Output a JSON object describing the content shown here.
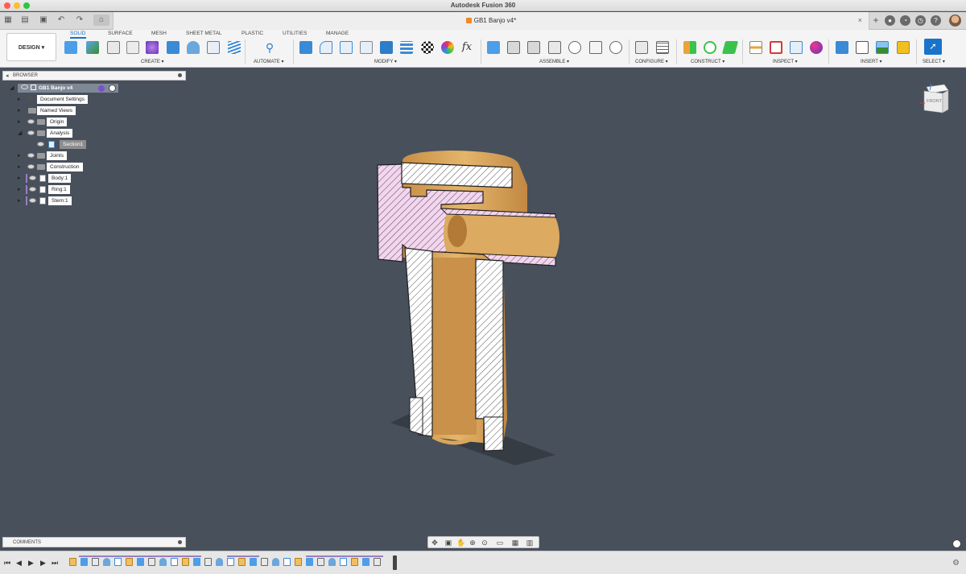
{
  "app": {
    "title": "Autodesk Fusion 360"
  },
  "document_tab": {
    "label": "GB1 Banjo v4*",
    "close": "×"
  },
  "toolbar": {
    "workspace": "DESIGN ▾",
    "tabs": [
      "SOLID",
      "SURFACE",
      "MESH",
      "SHEET METAL",
      "PLASTIC",
      "UTILITIES",
      "MANAGE"
    ],
    "active_tab": "SOLID",
    "groups": [
      "CREATE ▾",
      "AUTOMATE ▾",
      "MODIFY ▾",
      "ASSEMBLE ▾",
      "CONFIGURE ▾",
      "CONSTRUCT ▾",
      "INSPECT ▾",
      "INSERT ▾",
      "SELECT ▾"
    ],
    "fx_label": "fx"
  },
  "browser": {
    "title": "BROWSER",
    "root": "GB1 Banjo v4",
    "items": [
      {
        "label": "Document Settings",
        "icon": "gear-icon"
      },
      {
        "label": "Named Views",
        "icon": "folder-icon"
      },
      {
        "label": "Origin",
        "icon": "folder-icon"
      },
      {
        "label": "Analysis",
        "icon": "folder-icon"
      },
      {
        "label": "Section1",
        "icon": "section-analysis-icon",
        "selected": true
      },
      {
        "label": "Joints",
        "icon": "folder-icon"
      },
      {
        "label": "Construction",
        "icon": "folder-icon"
      },
      {
        "label": "Body:1",
        "icon": "body-icon"
      },
      {
        "label": "Ring:1",
        "icon": "component-icon"
      },
      {
        "label": "Stem:1",
        "icon": "component-icon"
      }
    ]
  },
  "viewcube": {
    "face_label": "FRONT"
  },
  "comments": {
    "title": "COMMENTS"
  },
  "navbar": {
    "icons": [
      "orbit-icon",
      "look-at-icon",
      "pan-icon",
      "zoom-icon",
      "zoom-window-icon",
      "display-settings-icon",
      "grid-settings-icon",
      "viewports-icon"
    ]
  },
  "colors": {
    "viewport_bg": "#48505c",
    "body_tan": "#d9a65a",
    "section_hatch_pink": "#f3d5ef",
    "accent_blue": "#1a73c9"
  }
}
